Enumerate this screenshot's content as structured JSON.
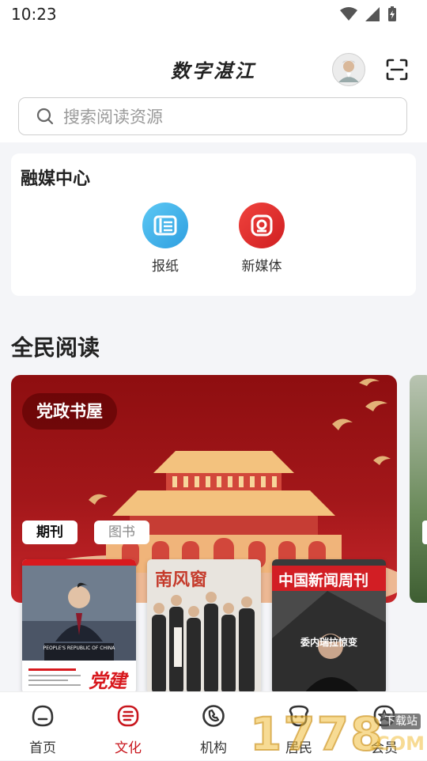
{
  "status_bar": {
    "time": "10:23"
  },
  "header": {
    "title": "数字湛江"
  },
  "search": {
    "placeholder": "搜索阅读资源"
  },
  "media_center": {
    "title": "融媒中心",
    "items": [
      {
        "label": "报纸",
        "icon": "newspaper-icon",
        "color": "#3db2ec"
      },
      {
        "label": "新媒体",
        "icon": "new-media-icon",
        "color": "#e2302f"
      }
    ]
  },
  "reading": {
    "title": "全民阅读",
    "banner": {
      "label": "党政书屋",
      "chips": [
        "期刊",
        "图书"
      ],
      "books": [
        {
          "title": "PEOPLE'S REPUBLIC OF CHINA",
          "side_text": "党建"
        },
        {
          "title": "南风窗"
        },
        {
          "title": "中国新闻周刊",
          "subtitle": "委内瑞拉惊变"
        }
      ]
    }
  },
  "tab_bar": {
    "tabs": [
      {
        "label": "首页",
        "icon": "home-icon"
      },
      {
        "label": "文化",
        "icon": "culture-icon",
        "active": true
      },
      {
        "label": "机构",
        "icon": "institution-icon"
      },
      {
        "label": "居民",
        "icon": "resident-icon"
      },
      {
        "label": "会员",
        "icon": "member-icon"
      }
    ]
  },
  "watermark": {
    "text": "1778",
    "suffix": ".COM",
    "badge": "下载站"
  },
  "colors": {
    "accent": "#c8161d"
  }
}
